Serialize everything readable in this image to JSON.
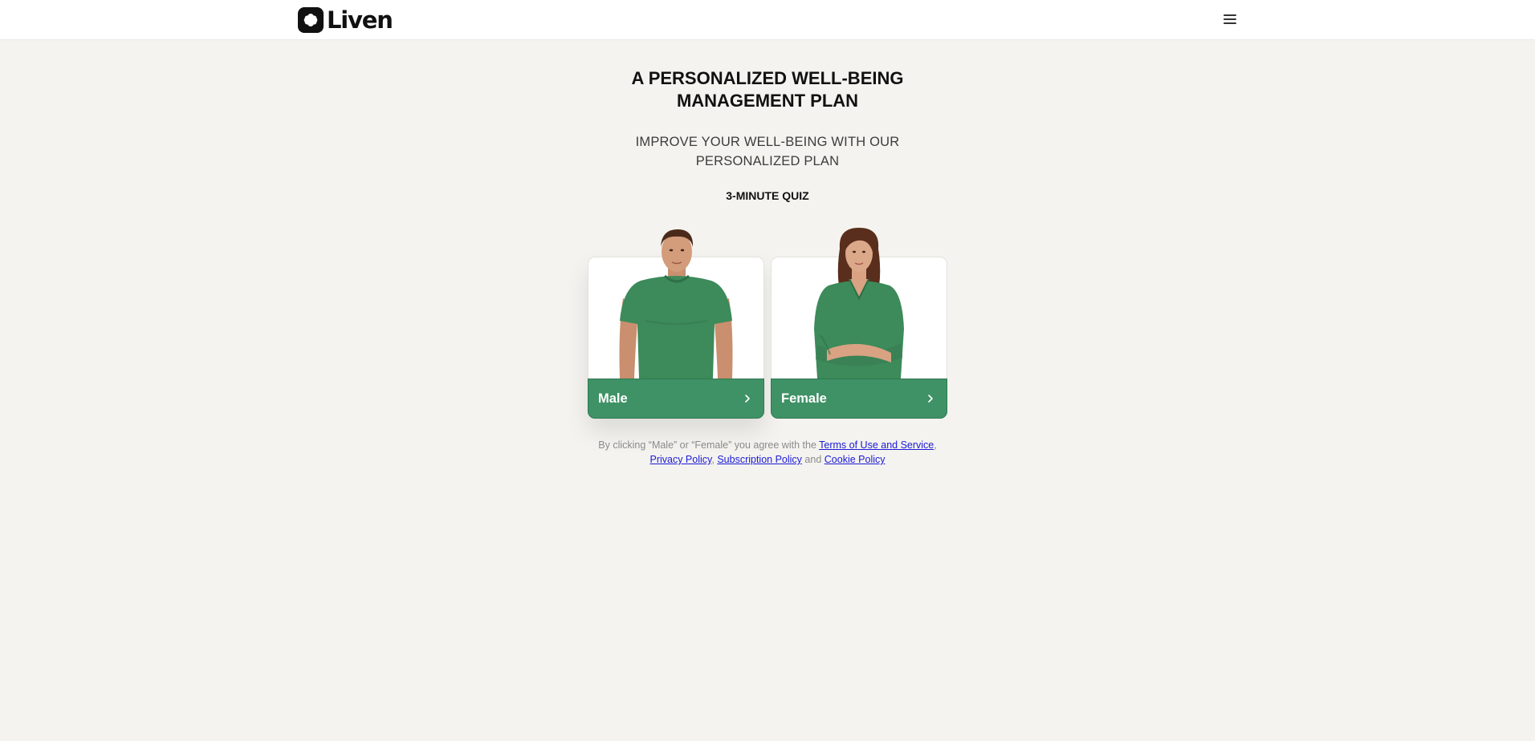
{
  "header": {
    "brand": "Liven",
    "menu_icon": "hamburger-menu-icon"
  },
  "hero": {
    "title": "A PERSONALIZED WELL-BEING MANAGEMENT PLAN",
    "subtitle": "IMPROVE YOUR WELL-BEING WITH OUR PERSONALIZED PLAN",
    "quiz_label": "3-MINUTE QUIZ"
  },
  "options": [
    {
      "label": "Male",
      "icon": "chevron-right-icon"
    },
    {
      "label": "Female",
      "icon": "chevron-right-icon"
    }
  ],
  "legal": {
    "prefix": "By clicking “Male” or “Female” you agree with the",
    "terms": "Terms of Use and Service",
    "sep1": ",",
    "privacy": "Privacy Policy",
    "sep2": ",",
    "subscription": "Subscription Policy",
    "and": "and",
    "cookie": "Cookie Policy"
  },
  "colors": {
    "background": "#f4f3ef",
    "accent_green": "#3f9166",
    "link": "#1a1ad6",
    "shirt_green": "#3d8a5a"
  }
}
